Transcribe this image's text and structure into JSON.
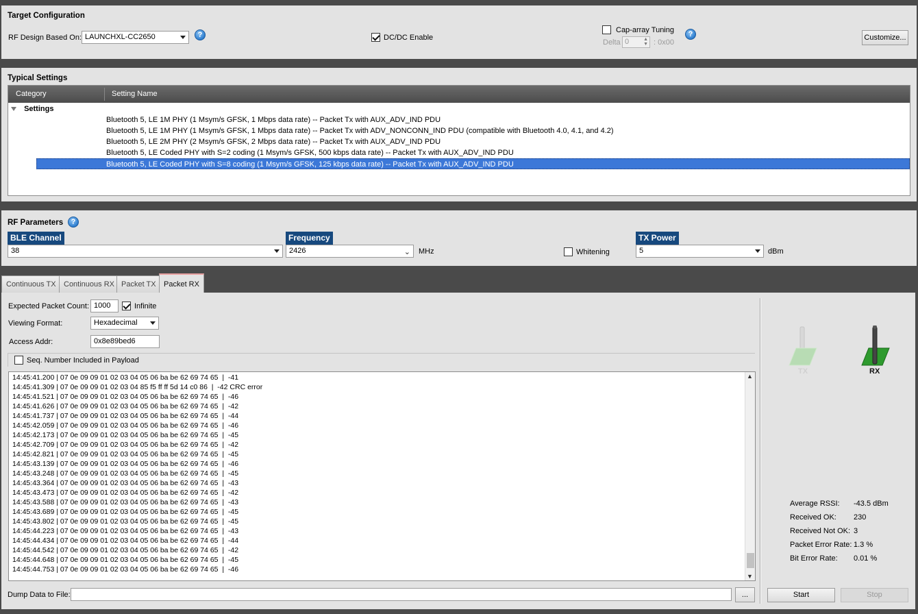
{
  "target_config": {
    "title": "Target Configuration",
    "rf_design_label": "RF Design Based On:",
    "rf_design_value": "LAUNCHXL-CC2650",
    "dcdc_label": "DC/DC Enable",
    "dcdc_checked": true,
    "cap_array_label": "Cap-array Tuning",
    "cap_array_checked": false,
    "delta_label": "Delta",
    "delta_value": "0",
    "delta_hex": ": 0x00",
    "customize_button": "Customize..."
  },
  "typical_settings": {
    "title": "Typical Settings",
    "columns": [
      "Category",
      "Setting Name"
    ],
    "group": "Settings",
    "rows": [
      "Bluetooth 5, LE 1M PHY (1 Msym/s GFSK, 1 Mbps data rate) -- Packet Tx with AUX_ADV_IND PDU",
      "Bluetooth 5, LE 1M PHY (1 Msym/s GFSK, 1 Mbps data rate) -- Packet Tx with ADV_NONCONN_IND PDU (compatible with Bluetooth 4.0, 4.1, and 4.2)",
      "Bluetooth 5, LE 2M PHY (2 Msym/s GFSK, 2 Mbps  data rate) -- Packet Tx with AUX_ADV_IND PDU",
      "Bluetooth 5, LE Coded PHY with S=2 coding (1 Msym/s GFSK, 500 kbps data rate) -- Packet Tx with AUX_ADV_IND PDU",
      "Bluetooth 5, LE Coded PHY with S=8 coding (1 Msym/s GFSK, 125 kbps data rate) -- Packet Tx with AUX_ADV_IND PDU"
    ],
    "selected_index": 4
  },
  "rf_params": {
    "title": "RF Parameters",
    "ble_channel_label": "BLE Channel",
    "ble_channel_value": "38",
    "frequency_label": "Frequency",
    "frequency_value": "2426",
    "frequency_unit": "MHz",
    "whitening_label": "Whitening",
    "whitening_checked": false,
    "tx_power_label": "TX Power",
    "tx_power_value": "5",
    "tx_power_unit": "dBm"
  },
  "tabs": [
    "Continuous TX",
    "Continuous RX",
    "Packet TX",
    "Packet RX"
  ],
  "active_tab": 3,
  "packet_rx": {
    "expected_count_label": "Expected Packet Count:",
    "expected_count_value": "1000",
    "infinite_label": "Infinite",
    "infinite_checked": true,
    "viewing_format_label": "Viewing Format:",
    "viewing_format_value": "Hexadecimal",
    "access_addr_label": "Access Addr:",
    "access_addr_value": "0x8e89bed6",
    "seq_label": "Seq. Number Included in Payload",
    "seq_checked": false,
    "log": [
      "14:45:41.200 | 07 0e 09 09 01 02 03 04 05 06 ba be 62 69 74 65  |  -41",
      "14:45:41.309 | 07 0e 09 09 01 02 03 04 85 f5 ff ff 5d 14 c0 86  |  -42 CRC error",
      "14:45:41.521 | 07 0e 09 09 01 02 03 04 05 06 ba be 62 69 74 65  |  -46",
      "14:45:41.626 | 07 0e 09 09 01 02 03 04 05 06 ba be 62 69 74 65  |  -42",
      "14:45:41.737 | 07 0e 09 09 01 02 03 04 05 06 ba be 62 69 74 65  |  -44",
      "14:45:42.059 | 07 0e 09 09 01 02 03 04 05 06 ba be 62 69 74 65  |  -46",
      "14:45:42.173 | 07 0e 09 09 01 02 03 04 05 06 ba be 62 69 74 65  |  -45",
      "14:45:42.709 | 07 0e 09 09 01 02 03 04 05 06 ba be 62 69 74 65  |  -42",
      "14:45:42.821 | 07 0e 09 09 01 02 03 04 05 06 ba be 62 69 74 65  |  -45",
      "14:45:43.139 | 07 0e 09 09 01 02 03 04 05 06 ba be 62 69 74 65  |  -46",
      "14:45:43.248 | 07 0e 09 09 01 02 03 04 05 06 ba be 62 69 74 65  |  -45",
      "14:45:43.364 | 07 0e 09 09 01 02 03 04 05 06 ba be 62 69 74 65  |  -43",
      "14:45:43.473 | 07 0e 09 09 01 02 03 04 05 06 ba be 62 69 74 65  |  -42",
      "14:45:43.588 | 07 0e 09 09 01 02 03 04 05 06 ba be 62 69 74 65  |  -43",
      "14:45:43.689 | 07 0e 09 09 01 02 03 04 05 06 ba be 62 69 74 65  |  -45",
      "14:45:43.802 | 07 0e 09 09 01 02 03 04 05 06 ba be 62 69 74 65  |  -45",
      "14:45:44.223 | 07 0e 09 09 01 02 03 04 05 06 ba be 62 69 74 65  |  -43",
      "14:45:44.434 | 07 0e 09 09 01 02 03 04 05 06 ba be 62 69 74 65  |  -44",
      "14:45:44.542 | 07 0e 09 09 01 02 03 04 05 06 ba be 62 69 74 65  |  -42",
      "14:45:44.648 | 07 0e 09 09 01 02 03 04 05 06 ba be 62 69 74 65  |  -45",
      "14:45:44.753 | 07 0e 09 09 01 02 03 04 05 06 ba be 62 69 74 65  |  -46"
    ],
    "dump_label": "Dump Data to File:",
    "dump_value": "",
    "browse_button": "...",
    "tx_icon_label": "TX",
    "rx_icon_label": "RX",
    "stats": [
      {
        "label": "Average RSSI:",
        "value": "-43.5 dBm"
      },
      {
        "label": "Received OK:",
        "value": "230"
      },
      {
        "label": "Received Not OK:",
        "value": "3"
      },
      {
        "label": "Packet Error Rate:",
        "value": "1.3 %"
      },
      {
        "label": "Bit Error Rate:",
        "value": "0.01 %"
      }
    ],
    "start_button": "Start",
    "stop_button": "Stop"
  }
}
